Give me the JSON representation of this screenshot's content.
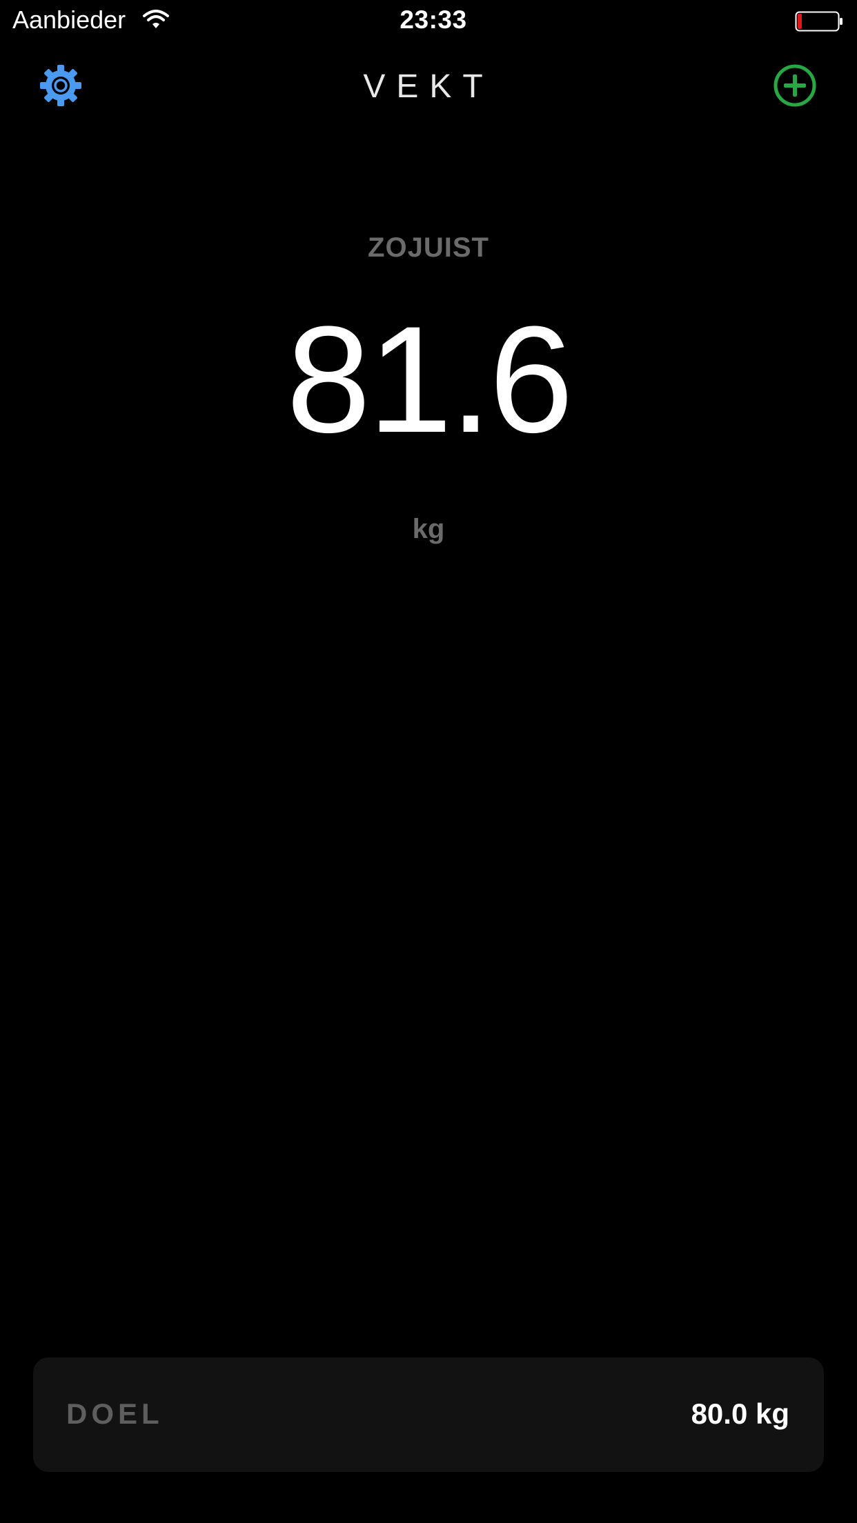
{
  "status_bar": {
    "carrier": "Aanbieder",
    "time": "23:33",
    "wifi_icon": "wifi-icon",
    "battery_icon": "battery-low-icon",
    "battery_level_fraction": 0.1,
    "battery_color": "#e0191e"
  },
  "nav": {
    "title": "VEKT",
    "settings_icon": "gear-icon",
    "settings_color": "#4a9af0",
    "add_icon": "plus-circle-icon",
    "add_color": "#28a745"
  },
  "measurement": {
    "timestamp_label": "ZOJUIST",
    "value": "81.6",
    "unit": "kg"
  },
  "goal": {
    "label": "DOEL",
    "value": "80.0 kg"
  }
}
